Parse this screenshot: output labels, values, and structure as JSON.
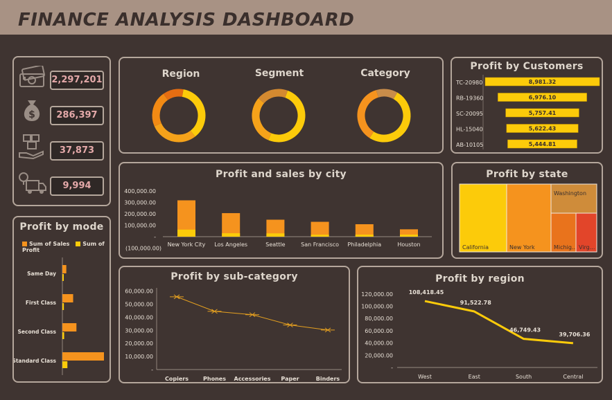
{
  "header": {
    "title": "FINANCE ANALYSIS DASHBOARD"
  },
  "kpis": [
    {
      "icon": "money-bills-icon",
      "value": "2,297,201"
    },
    {
      "icon": "money-bag-icon",
      "value": "286,397"
    },
    {
      "icon": "boxes-hand-icon",
      "value": "37,873"
    },
    {
      "icon": "delivery-truck-icon",
      "value": "9,994"
    }
  ],
  "donuts": [
    {
      "label": "Region"
    },
    {
      "label": "Segment"
    },
    {
      "label": "Category"
    }
  ],
  "profit_by_customers": {
    "title": "Profit by Customers",
    "chart_data": {
      "type": "bar",
      "categories": [
        "TC-20980",
        "RB-19360",
        "SC-20095",
        "HL-15040",
        "AB-10105"
      ],
      "values": [
        8981.32,
        6976.1,
        5757.41,
        5622.43,
        5444.81
      ],
      "labels": [
        "8,981.32",
        "6,976.10",
        "5,757.41",
        "5,622.43",
        "5,444.81"
      ]
    }
  },
  "profit_sales_city": {
    "title": "Profit and sales by city",
    "chart_data": {
      "type": "bar",
      "categories": [
        "New York City",
        "Los Angeles",
        "Seattle",
        "San Francisco",
        "Philadelphia",
        "Houston"
      ],
      "series": [
        {
          "name": "Sum of Sales",
          "values": [
            256368,
            175851,
            119541,
            112669,
            109077,
            64505
          ]
        },
        {
          "name": "Sum of Profit",
          "values": [
            62037,
            30441,
            29156,
            17507,
            -13838,
            -10154
          ]
        }
      ],
      "yticks": [
        "400,000.00",
        "300,000.00",
        "200,000.00",
        "100,000.00",
        "-",
        "(100,000.00)"
      ],
      "ylim": [
        -100000,
        400000
      ]
    }
  },
  "profit_by_state": {
    "title": "Profit by state",
    "chart_data": {
      "type": "treemap",
      "categories": [
        "California",
        "New York",
        "Washington",
        "Michigan",
        "Virginia"
      ],
      "labels": [
        "California",
        "New York",
        "Washington",
        "Michig...",
        "Virg..."
      ],
      "colors": [
        "#fccb0a",
        "#f5931e",
        "#cf8c3a",
        "#e9731c",
        "#e2452a"
      ]
    }
  },
  "profit_by_mode": {
    "title": "Profit by mode",
    "legend": [
      "Sum of Sales",
      "Sum of Profit"
    ],
    "chart_data": {
      "type": "bar",
      "categories": [
        "Same Day",
        "First Class",
        "Second Class",
        "Standard Class"
      ],
      "series": [
        {
          "name": "Sum of Sales",
          "values": [
            128363,
            351428,
            459194,
            1358216
          ]
        },
        {
          "name": "Sum of Profit",
          "values": [
            15892,
            48970,
            57447,
            164089
          ]
        }
      ]
    }
  },
  "profit_by_subcategory": {
    "title": "Profit by sub-category",
    "chart_data": {
      "type": "line",
      "categories": [
        "Copiers",
        "Phones",
        "Accessories",
        "Paper",
        "Binders"
      ],
      "values": [
        55618,
        44516,
        41937,
        34054,
        30222
      ],
      "yticks": [
        "60,000.00",
        "50,000.00",
        "40,000.00",
        "30,000.00",
        "20,000.00",
        "10,000.00",
        "-"
      ],
      "ylim": [
        0,
        60000
      ]
    }
  },
  "profit_by_region": {
    "title": "Profit by region",
    "chart_data": {
      "type": "line",
      "categories": [
        "West",
        "East",
        "South",
        "Central"
      ],
      "values": [
        108418.45,
        91522.78,
        46749.43,
        39706.36
      ],
      "labels": [
        "108,418.45",
        "91,522.78",
        "46,749.43",
        "39,706.36"
      ],
      "yticks": [
        "120,000.00",
        "100,000.00",
        "80,000.00",
        "60,000.00",
        "40,000.00",
        "20,000.00",
        "-"
      ],
      "ylim": [
        0,
        120000
      ]
    }
  },
  "colors": {
    "background": "#3f3431",
    "header": "#a89284",
    "border": "#b5a79c",
    "bar": "#fccb0a",
    "accent": "#f5931e",
    "kpi_text": "#e4a9a9"
  }
}
